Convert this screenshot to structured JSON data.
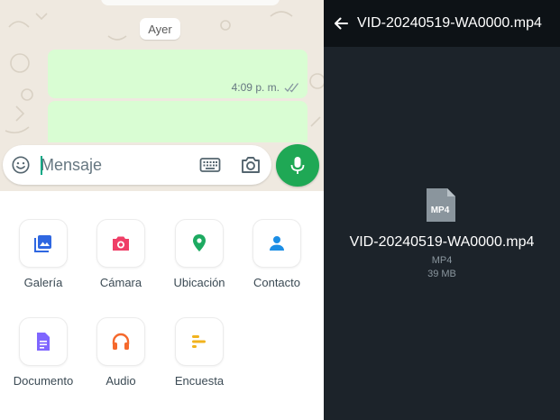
{
  "chat": {
    "date_chip": "Ayer",
    "messages": [
      {
        "time": "4:09 p. m.",
        "status": "read"
      },
      {
        "time": ""
      }
    ],
    "composer": {
      "placeholder": "Mensaje",
      "icons": [
        "emoji-icon",
        "keyboard-icon",
        "camera-icon",
        "mic-icon"
      ]
    }
  },
  "attachments": [
    {
      "label": "Galería",
      "icon": "gallery-icon",
      "color": "#2f67e1"
    },
    {
      "label": "Cámara",
      "icon": "camera-icon",
      "color": "#ef3f67"
    },
    {
      "label": "Ubicación",
      "icon": "location-icon",
      "color": "#1daa61"
    },
    {
      "label": "Contacto",
      "icon": "contact-icon",
      "color": "#1c8ee5"
    },
    {
      "label": "Documento",
      "icon": "document-icon",
      "color": "#7f66ff"
    },
    {
      "label": "Audio",
      "icon": "headphones-icon",
      "color": "#f5692d"
    },
    {
      "label": "Encuesta",
      "icon": "poll-icon",
      "color": "#f1b31e"
    }
  ],
  "viewer": {
    "title": "VID-20240519-WA0000.mp4",
    "file_icon_label": "MP4",
    "file_name": "VID-20240519-WA0000.mp4",
    "file_type": "MP4",
    "file_size": "39 MB"
  },
  "colors": {
    "bubble_out": "#d9fdd3",
    "accent_green": "#1fa855",
    "viewer_bg": "#1c232a",
    "viewer_header": "#0d1216",
    "chat_wallpaper": "#efe9e0"
  }
}
